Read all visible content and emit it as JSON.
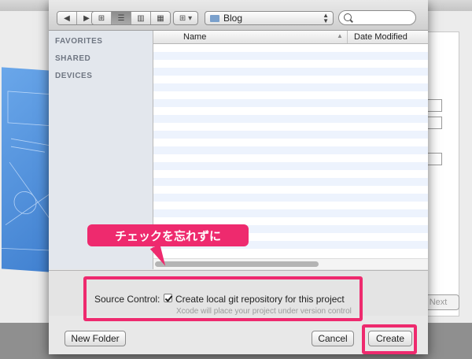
{
  "toolbar": {
    "back_icon": "chevron-left-icon",
    "forward_icon": "chevron-right-icon",
    "location": "Blog",
    "search_placeholder": ""
  },
  "sidebar": {
    "sections": [
      "FAVORITES",
      "SHARED",
      "DEVICES"
    ]
  },
  "file_list": {
    "columns": [
      "Name",
      "Date Modified"
    ],
    "rows": []
  },
  "options": {
    "source_control_label": "Source Control:",
    "git_checkbox_label": "Create local git repository for this project",
    "git_checked": true,
    "git_hint": "Xcode will place your project under version control"
  },
  "buttons": {
    "new_folder": "New Folder",
    "cancel": "Cancel",
    "create": "Create"
  },
  "background_window": {
    "next_button": "Next"
  },
  "annotation": {
    "callout_text": "チェックを忘れずに",
    "highlight_color": "#ee2a6e"
  }
}
